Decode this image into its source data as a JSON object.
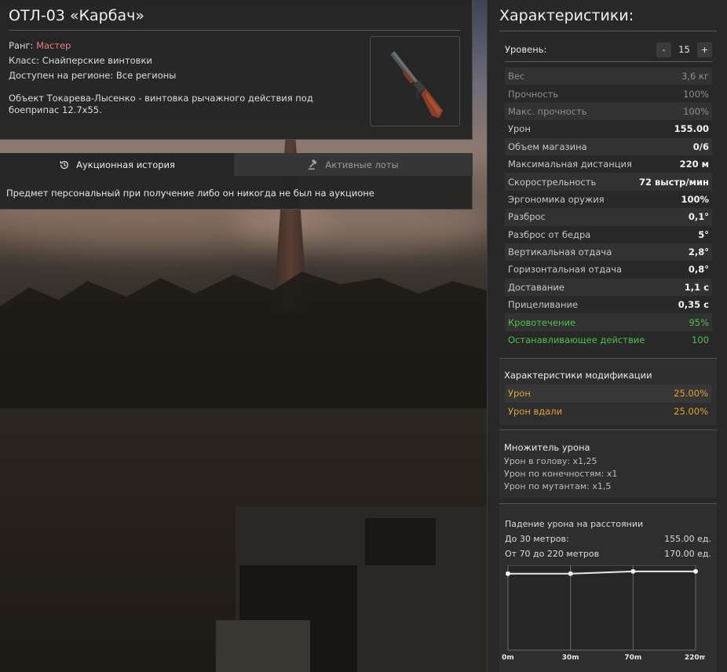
{
  "item": {
    "title": "ОТЛ-03 «Карбач»",
    "rank_label": "Ранг: ",
    "rank_value": "Мастер",
    "class_line": "Класс: Снайперские винтовки",
    "region_line": "Доступен на регионе: Все регионы",
    "description": "Объект Токарева-Лысенко - винтовка рычажного действия под боеприпас 12.7x55.",
    "thumbnail_icon": "lever-action-rifle-icon"
  },
  "auction": {
    "tabs": [
      {
        "label": "Аукционная история",
        "icon": "history-icon",
        "active": true
      },
      {
        "label": "Активные лоты",
        "icon": "gavel-icon",
        "active": false
      }
    ],
    "message": "Предмет персональный при получение либо он никогда не был на аукционе"
  },
  "sidebar": {
    "title": "Характеристики:",
    "level": {
      "label": "Уровень:",
      "minus": "-",
      "value": "15",
      "plus": "+"
    },
    "stats": [
      {
        "label": "Вес",
        "value": "3,6 кг",
        "style": "dim"
      },
      {
        "label": "Прочность",
        "value": "100%",
        "style": "dim"
      },
      {
        "label": "Макс. прочность",
        "value": "100%",
        "style": "dim"
      },
      {
        "label": "Урон",
        "value": "155.00",
        "style": "bright"
      },
      {
        "label": "Объем магазина",
        "value": "0/6",
        "style": "bright"
      },
      {
        "label": "Максимальная дистанция",
        "value": "220 м",
        "style": "bright"
      },
      {
        "label": "Скорострельность",
        "value": "72 выстр/мин",
        "style": "bright"
      },
      {
        "label": "Эргономика оружия",
        "value": "100%",
        "style": "bright"
      },
      {
        "label": "Разброс",
        "value": "0,1°",
        "style": "bright"
      },
      {
        "label": "Разброс от бедра",
        "value": "5°",
        "style": "bright"
      },
      {
        "label": "Вертикальная отдача",
        "value": "2,8°",
        "style": "bright"
      },
      {
        "label": "Горизонтальная отдача",
        "value": "0,8°",
        "style": "bright"
      },
      {
        "label": "Доставание",
        "value": "1,1 с",
        "style": "bright"
      },
      {
        "label": "Прицеливание",
        "value": "0,35 с",
        "style": "bright"
      },
      {
        "label": "Кровотечение",
        "value": "95%",
        "style": "green"
      },
      {
        "label": "Останавливающее действие",
        "value": "100",
        "style": "green"
      }
    ],
    "mods": {
      "title": "Характеристики модификации",
      "rows": [
        {
          "label": "Урон",
          "value": "25.00%"
        },
        {
          "label": "Урон вдали",
          "value": "25.00%"
        }
      ]
    },
    "multiplier": {
      "title": "Множитель урона",
      "lines": [
        "Урон в голову: x1,25",
        "Урон по конечностям: x1",
        "Урон по мутантам: x1,5"
      ]
    },
    "falloff": {
      "title": "Падение урона на расстоянии",
      "rows": [
        {
          "label": "До 30 метров:",
          "value": "155.00 ед."
        },
        {
          "label": "От 70 до 220 метров",
          "value": "170.00 ед."
        }
      ]
    }
  },
  "colors": {
    "rank": "#e8807a",
    "stat_green": "#4fc04f",
    "mod_orange": "#e0a237"
  },
  "chart_data": {
    "type": "line",
    "x": [
      0,
      30,
      70,
      220
    ],
    "categories": [
      "0m",
      "30m",
      "70m",
      "220m"
    ],
    "series": [
      {
        "values": [
          155,
          155,
          170,
          170
        ]
      }
    ],
    "title": "",
    "xlabel": "",
    "ylabel": "",
    "grid": true
  }
}
